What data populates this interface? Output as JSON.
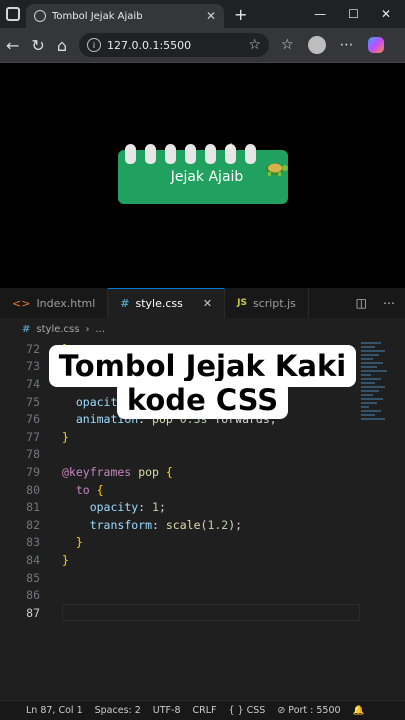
{
  "browser": {
    "tab_title": "Tombol Jejak Ajaib",
    "tab_close": "✕",
    "new_tab": "+",
    "minimize": "—",
    "maximize": "☐",
    "close": "✕",
    "url": "127.0.0.1:5500"
  },
  "page": {
    "button_label": "Jejak Ajaib",
    "cursor": "☝"
  },
  "editor": {
    "tabs": [
      {
        "label": "Index.html"
      },
      {
        "label": "style.css",
        "close": "✕"
      },
      {
        "label": "script.js"
      }
    ],
    "breadcrumb_file": "style.css",
    "breadcrumb_more": "...",
    "lines": [
      {
        "n": "72",
        "t": "}"
      },
      {
        "n": "73",
        "t": ""
      },
      {
        "n": "74",
        "t": ""
      },
      {
        "n": "75",
        "t": "  opacity: 0;"
      },
      {
        "n": "76",
        "t": "  animation: pop 0.3s forwards;"
      },
      {
        "n": "77",
        "t": "}"
      },
      {
        "n": "78",
        "t": ""
      },
      {
        "n": "79",
        "t": "@keyframes pop {"
      },
      {
        "n": "80",
        "t": "  to {"
      },
      {
        "n": "81",
        "t": "    opacity: 1;"
      },
      {
        "n": "82",
        "t": "    transform: scale(1.2);"
      },
      {
        "n": "83",
        "t": "  }"
      },
      {
        "n": "84",
        "t": "}"
      },
      {
        "n": "85",
        "t": ""
      },
      {
        "n": "86",
        "t": ""
      },
      {
        "n": "87",
        "t": ""
      }
    ]
  },
  "caption": {
    "line1": "Tombol Jejak Kaki",
    "line2": "kode CSS"
  },
  "status": {
    "position": "Ln 87, Col 1",
    "spaces": "Spaces: 2",
    "encoding": "UTF-8",
    "eol": "CRLF",
    "language": "{ } CSS",
    "port": "⊘ Port : 5500"
  }
}
